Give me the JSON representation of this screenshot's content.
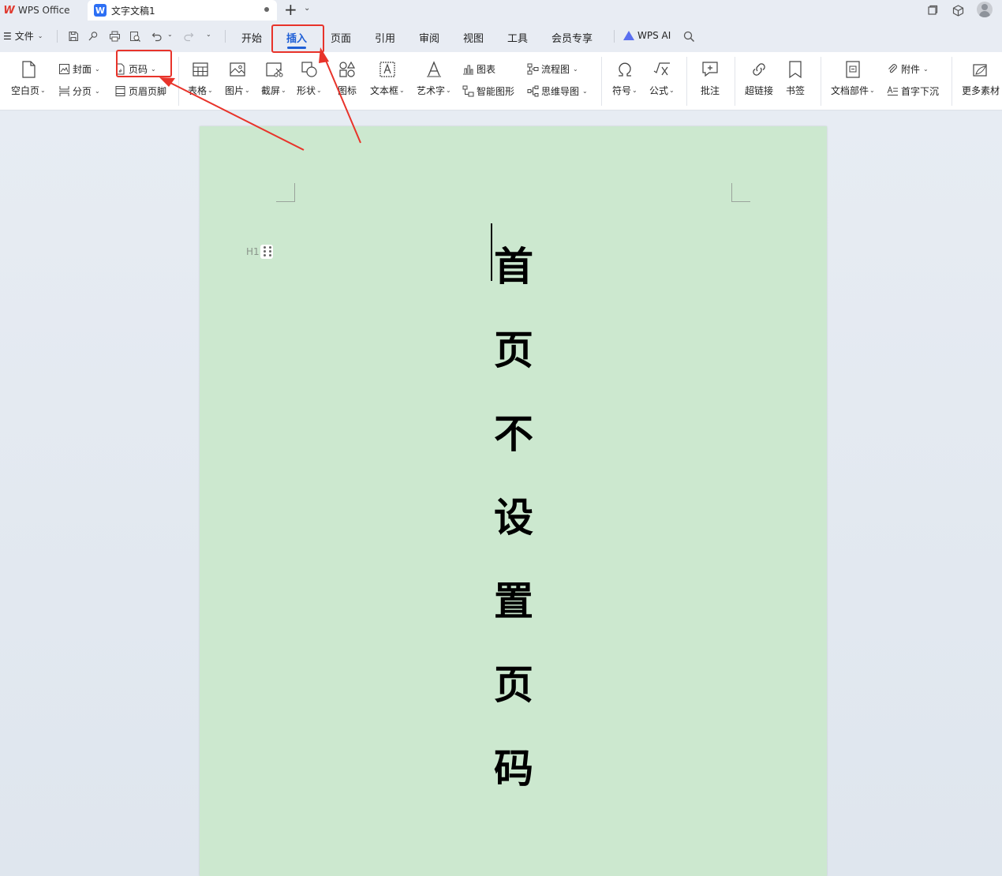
{
  "titlebar": {
    "app_name": "WPS Office",
    "doc_tab_title": "文字文稿1",
    "doc_icon_letter": "W",
    "new_tab": "+"
  },
  "menubar": {
    "file_label": "文件",
    "tabs": [
      "开始",
      "插入",
      "页面",
      "引用",
      "审阅",
      "视图",
      "工具",
      "会员专享"
    ],
    "active_tab": "插入",
    "ai_label": "WPS AI",
    "accent_color": "#1f5fd6"
  },
  "ribbon": {
    "blank_page": "空白页",
    "cover": "封面",
    "page_break": "分页",
    "page_number": "页码",
    "header_footer": "页眉页脚",
    "table": "表格",
    "picture": "图片",
    "screenshot": "截屏",
    "shape": "形状",
    "icon": "图标",
    "textbox": "文本框",
    "wordart": "艺术字",
    "chart": "图表",
    "smartart": "智能图形",
    "flowchart": "流程图",
    "mindmap": "思维导图",
    "symbol": "符号",
    "formula": "公式",
    "comment": "批注",
    "hyperlink": "超链接",
    "bookmark": "书签",
    "doc_parts": "文档部件",
    "attachment": "附件",
    "drop_cap": "首字下沉",
    "more_assets": "更多素材"
  },
  "document": {
    "page_color": "#cce8cf",
    "heading_marker": "H1",
    "vertical_chars": [
      "首",
      "页",
      "不",
      "设",
      "置",
      "页",
      "码"
    ]
  },
  "annotations": {
    "highlight_color": "#e8332a",
    "highlighted": [
      "插入",
      "页码"
    ]
  }
}
